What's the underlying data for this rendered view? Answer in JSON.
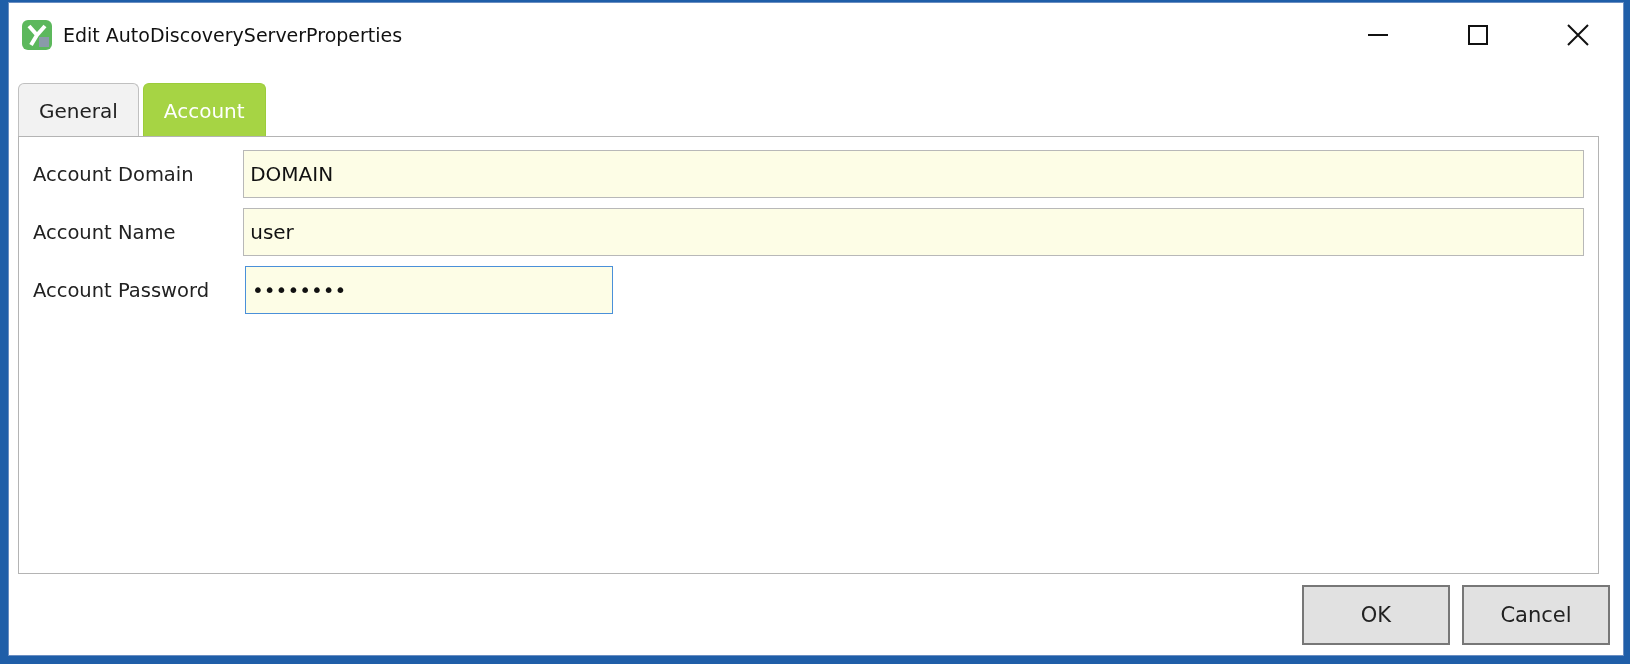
{
  "window": {
    "title": "Edit AutoDiscoveryServerProperties"
  },
  "tabs": [
    {
      "label": "General",
      "selected": false
    },
    {
      "label": "Account",
      "selected": true
    }
  ],
  "fields": [
    {
      "label": "Account Domain",
      "value": "DOMAIN",
      "kind": "wide",
      "focused": false
    },
    {
      "label": "Account Name",
      "value": "user",
      "kind": "wide",
      "focused": false
    },
    {
      "label": "Account Password",
      "value": "••••••••",
      "kind": "narrow",
      "focused": true
    }
  ],
  "buttons": [
    "OK",
    "Cancel"
  ]
}
